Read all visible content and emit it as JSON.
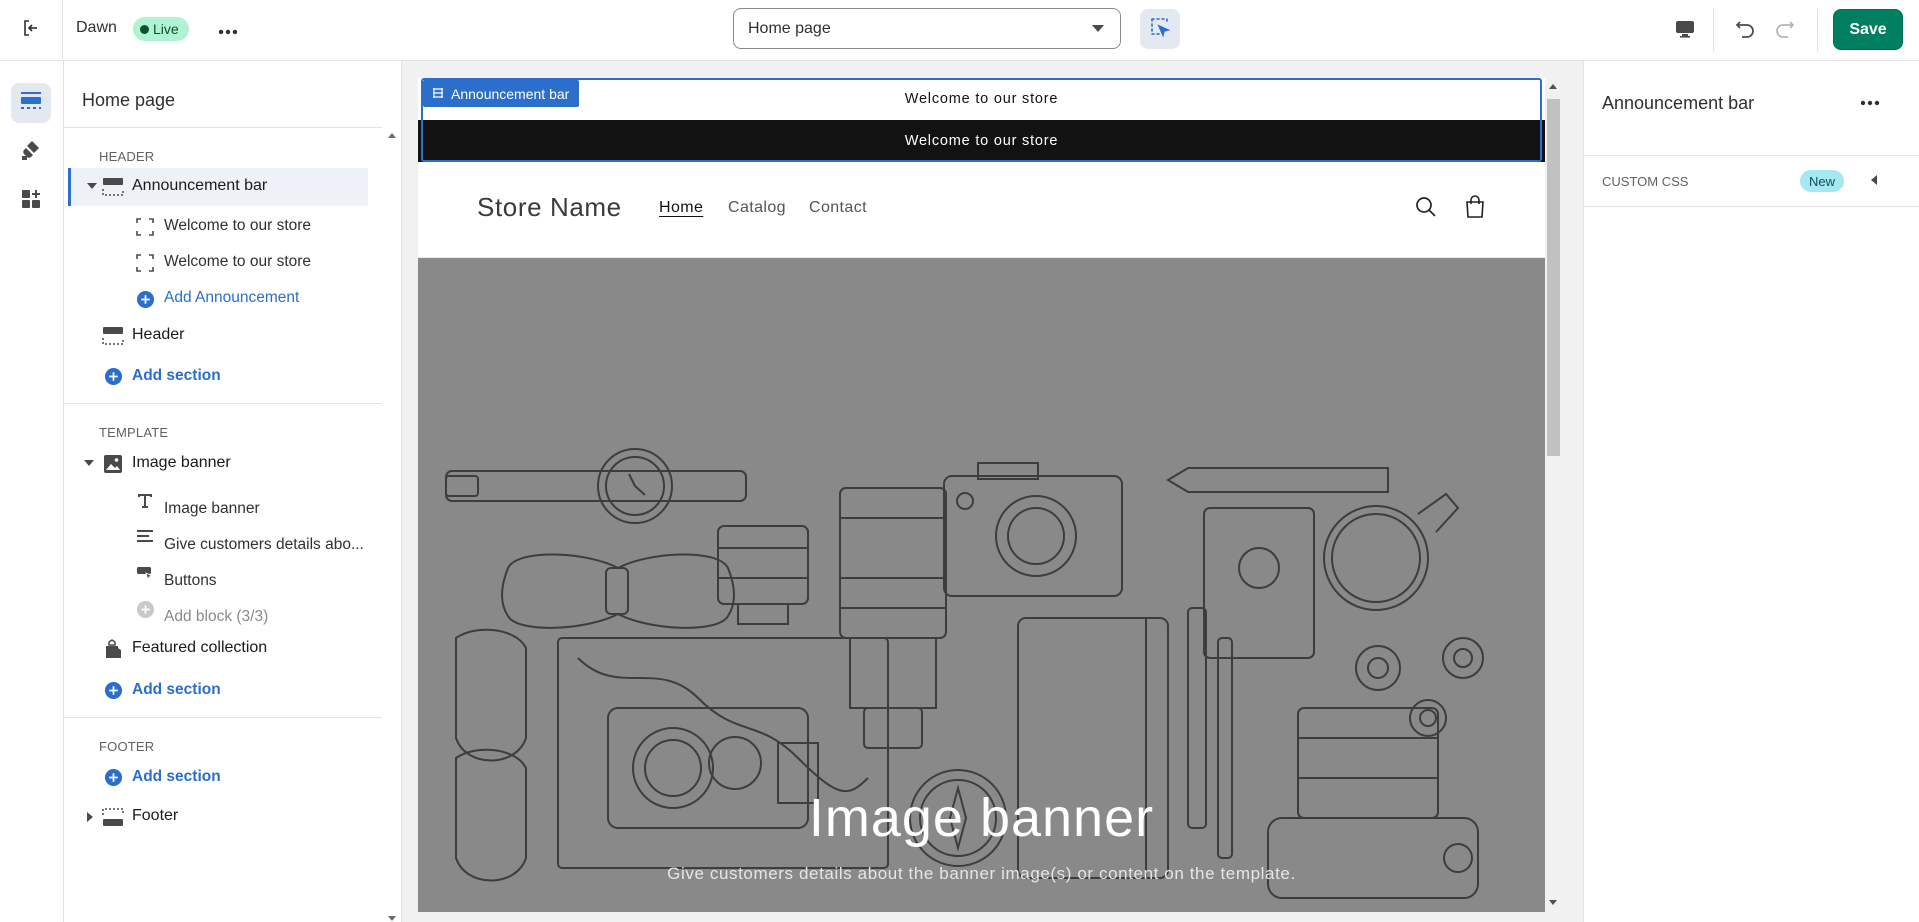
{
  "topbar": {
    "theme_name": "Dawn",
    "live_label": "Live",
    "page_select_value": "Home page",
    "save_label": "Save"
  },
  "sidebar": {
    "title": "Home page",
    "header_group": "HEADER",
    "template_group": "TEMPLATE",
    "footer_group": "FOOTER",
    "announcement_bar": "Announcement bar",
    "announcement_block_1": "Welcome to our store",
    "announcement_block_2": "Welcome to our store",
    "add_announcement": "Add Announcement",
    "header": "Header",
    "add_section": "Add section",
    "image_banner": "Image banner",
    "image_banner_heading_block": "Image banner",
    "image_banner_text_block": "Give customers details abo...",
    "image_banner_buttons_block": "Buttons",
    "add_block": "Add block (3/3)",
    "featured_collection": "Featured collection",
    "footer": "Footer"
  },
  "preview": {
    "selection_tag": "Announcement bar",
    "announcement_1": "Welcome to our store",
    "announcement_2": "Welcome to our store",
    "store_name": "Store Name",
    "nav": [
      "Home",
      "Catalog",
      "Contact"
    ],
    "banner_heading": "Image banner",
    "banner_subheading": "Give customers details about the banner image(s) or content on the template."
  },
  "right_panel": {
    "title": "Announcement bar",
    "custom_css_label": "CUSTOM CSS",
    "new_badge": "New"
  },
  "colors": {
    "accent": "#2c6ecb",
    "save_green": "#008060",
    "live_badge_bg": "#aff3d2",
    "new_badge_bg": "#a4e8f2",
    "banner_bg": "#898989",
    "announcement_dark": "#121212"
  }
}
